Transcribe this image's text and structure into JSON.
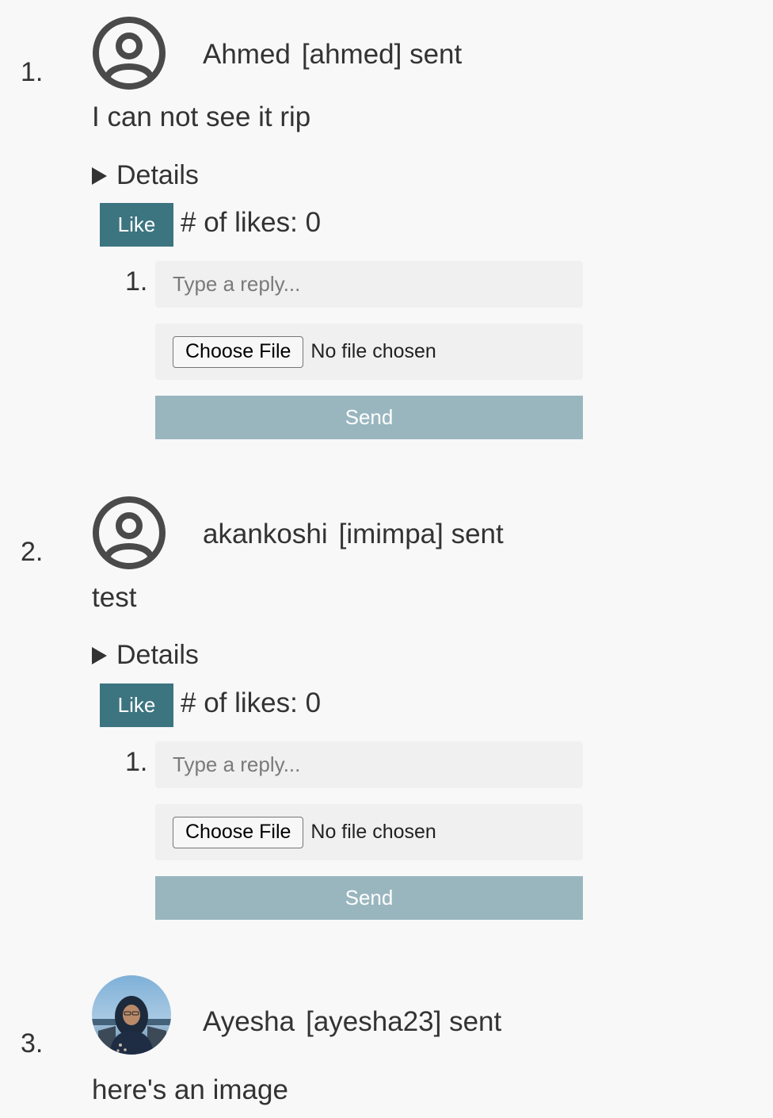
{
  "posts": [
    {
      "number": "1.",
      "author": "Ahmed",
      "username": "[ahmed] sent",
      "message": "I can not see it rip",
      "details_label": "Details",
      "like_label": "Like",
      "likes_text": "# of likes: 0",
      "reply_number": "1.",
      "reply_placeholder": "Type a reply...",
      "choose_file_label": "Choose File",
      "no_file_text": "No file chosen",
      "send_label": "Send",
      "avatar": "user-circle-icon"
    },
    {
      "number": "2.",
      "author": "akankoshi",
      "username": "[imimpa] sent",
      "message": "test",
      "details_label": "Details",
      "like_label": "Like",
      "likes_text": "# of likes: 0",
      "reply_number": "1.",
      "reply_placeholder": "Type a reply...",
      "choose_file_label": "Choose File",
      "no_file_text": "No file chosen",
      "send_label": "Send",
      "avatar": "user-circle-icon"
    },
    {
      "number": "3.",
      "author": "Ayesha",
      "username": "[ayesha23] sent",
      "message": "here's an image",
      "avatar": "profile-photo"
    }
  ],
  "colors": {
    "like_button": "#3c7480",
    "send_button": "#99b6bf",
    "background": "#f8f8f8",
    "input_background": "#f0f0f0"
  }
}
